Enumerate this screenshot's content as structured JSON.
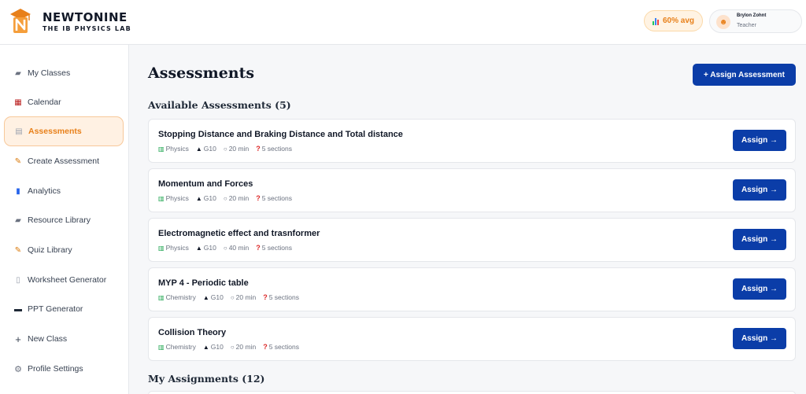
{
  "brand": {
    "name": "NEWTONINE",
    "subtitle": "THE IB PHYSICS LAB"
  },
  "header": {
    "avg_label": "60% avg",
    "user": {
      "name": "Brylon Zohnt",
      "role": "Teacher"
    }
  },
  "sidebar": {
    "items": [
      {
        "label": "My Classes",
        "icon": "folder-icon",
        "glyph": "▰"
      },
      {
        "label": "Calendar",
        "icon": "calendar-icon",
        "glyph": "▦"
      },
      {
        "label": "Assessments",
        "icon": "clipboard-icon",
        "glyph": "▤",
        "active": true
      },
      {
        "label": "Create Assessment",
        "icon": "pencil-icon",
        "glyph": "✎"
      },
      {
        "label": "Analytics",
        "icon": "bar-chart-icon",
        "glyph": "▮"
      },
      {
        "label": "Resource Library",
        "icon": "folder-icon",
        "glyph": "▰"
      },
      {
        "label": "Quiz Library",
        "icon": "notepad-icon",
        "glyph": "✎"
      },
      {
        "label": "Worksheet Generator",
        "icon": "document-icon",
        "glyph": "▯"
      },
      {
        "label": "PPT Generator",
        "icon": "monitor-icon",
        "glyph": "▬"
      },
      {
        "label": "New Class",
        "icon": "plus-icon",
        "glyph": "+"
      },
      {
        "label": "Profile Settings",
        "icon": "gear-icon",
        "glyph": "⚙"
      }
    ]
  },
  "main": {
    "title": "Assessments",
    "assign_assessment_label": "+ Assign Assessment",
    "available_title": "Available Assessments (5)",
    "my_assignments_title": "My Assignments (12)",
    "assign_label": "Assign →",
    "assessments": [
      {
        "title": "Stopping Distance and Braking Distance and Total distance",
        "subject": "Physics",
        "grade": "G10",
        "duration": "20 min",
        "sections": "5 sections"
      },
      {
        "title": "Momentum and Forces",
        "subject": "Physics",
        "grade": "G10",
        "duration": "20 min",
        "sections": "5 sections"
      },
      {
        "title": "Electromagnetic effect and trasnformer",
        "subject": "Physics",
        "grade": "G10",
        "duration": "40 min",
        "sections": "5 sections"
      },
      {
        "title": "MYP 4 - Periodic table",
        "subject": "Chemistry",
        "grade": "G10",
        "duration": "20 min",
        "sections": "5 sections"
      },
      {
        "title": "Collision Theory",
        "subject": "Chemistry",
        "grade": "G10",
        "duration": "20 min",
        "sections": "5 sections"
      }
    ]
  },
  "colors": {
    "accent": "#e8801a",
    "primary": "#0b3da8"
  }
}
